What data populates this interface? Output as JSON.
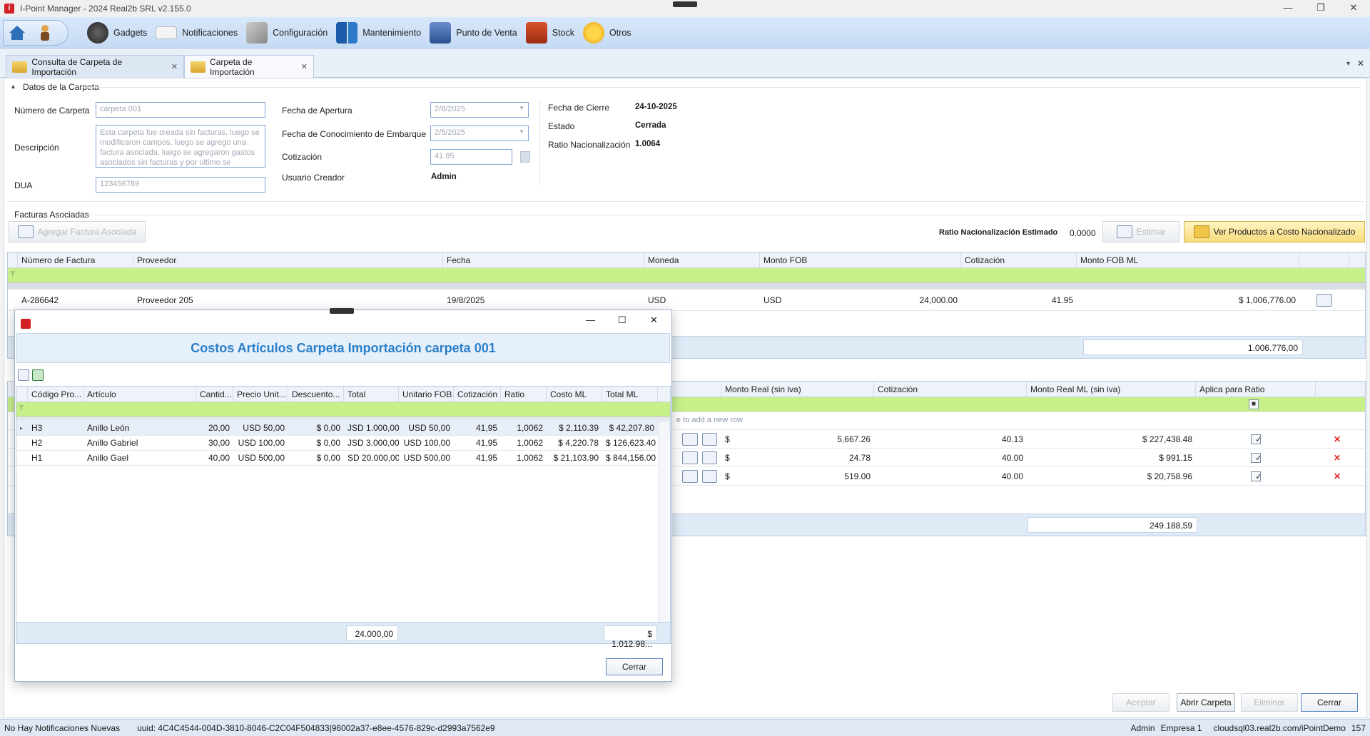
{
  "window": {
    "title": "I-Point Manager - 2024 Real2b SRL v2.155.0",
    "minimize": "—",
    "maximize": "❐",
    "close": "✕"
  },
  "menu": {
    "items": [
      "Gadgets",
      "Notificaciones",
      "Configuración",
      "Mantenimiento",
      "Punto de Venta",
      "Stock",
      "Otros"
    ]
  },
  "tabs": [
    {
      "label": "Consulta de Carpeta de Importación",
      "close": "✕"
    },
    {
      "label": "Carpeta de Importación",
      "close": "✕"
    }
  ],
  "tabstrip_icons": {
    "dropdown": "▼",
    "close": "✕"
  },
  "datos": {
    "section": "Datos de la Carpeta",
    "numero_label": "Número de Carpeta",
    "numero_value": "carpeta 001",
    "descripcion_label": "Descripción",
    "descripcion_value": "Esta carpeta fue creada sin facturas, luego se modificaron campos, luego se agrego una factura asociada, luego se agregaron gastos asociados sin facturas y por ultimo se",
    "dua_label": "DUA",
    "dua_value": "123456789",
    "apertura_label": "Fecha de Apertura",
    "apertura_value": "2/8/2025",
    "embarque_label": "Fecha de Conocimiento de Embarque",
    "embarque_value": "2/5/2025",
    "cotizacion_label": "Cotización",
    "cotizacion_value": "41.95",
    "usuario_label": "Usuario Creador",
    "usuario_value": "Admin",
    "cierre_label": "Fecha de Cierre",
    "cierre_value": "24-10-2025",
    "estado_label": "Estado",
    "estado_value": "Cerrada",
    "ratio_label": "Ratio Nacionalización",
    "ratio_value": "1.0064"
  },
  "facturas": {
    "section": "Facturas Asociadas",
    "agregar": "Agregar Factura Asociada",
    "ratio_est_label": "Ratio Nacionalización Estimado",
    "ratio_est_value": "0.0000",
    "estimar": "Estimar",
    "ver_productos": "Ver Productos a Costo Nacionalizado",
    "headers": [
      "Número de Factura",
      "Proveedor",
      "Fecha",
      "Moneda",
      "Monto FOB",
      "Cotización",
      "Monto FOB ML"
    ],
    "rows": [
      [
        "A-286642",
        "Proveedor 205",
        "19/8/2025",
        "USD",
        "USD",
        "24,000.00",
        "41.95",
        "$ 1,006,776.00"
      ]
    ],
    "total": "1.006.776,00"
  },
  "gastos": {
    "headers": [
      "Monto Real (sin iva)",
      "Cotización",
      "Monto Real ML (sin iva)",
      "Aplica para Ratio"
    ],
    "new_row": "e to add a new row",
    "rows": [
      [
        "$",
        "5,667.26",
        "40.13",
        "$ 227,438.48"
      ],
      [
        "$",
        "24.78",
        "40.00",
        "$ 991.15"
      ],
      [
        "$",
        "519.00",
        "40.00",
        "$ 20,758.96"
      ]
    ],
    "total": "249.188,59"
  },
  "footer_buttons": {
    "aceptar": "Aceptar",
    "abrir": "Abrir Carpeta",
    "eliminar": "Eliminar",
    "cerrar": "Cerrar"
  },
  "dialog": {
    "title": "Costos Artículos Carpeta Importación carpeta 001",
    "headers": [
      "Código Pro...",
      "Artículo",
      "Cantid...",
      "Precio Unit...",
      "Descuento...",
      "Total",
      "Unitario FOB",
      "Cotización",
      "Ratio",
      "Costo ML",
      "Total ML"
    ],
    "rows": [
      [
        "H3",
        "Anillo León",
        "20,00",
        "USD 50,00",
        "$ 0,00",
        "JSD 1.000,00",
        "USD 50,00",
        "41,95",
        "1,0062",
        "$ 2,110.39",
        "$ 42,207.80"
      ],
      [
        "H2",
        "Anillo Gabriel",
        "30,00",
        "USD 100,00",
        "$ 0,00",
        "JSD 3.000,00",
        "USD 100,00",
        "41,95",
        "1,0062",
        "$ 4,220.78",
        "$ 126,623.40"
      ],
      [
        "H1",
        "Anillo Gael",
        "40,00",
        "USD 500,00",
        "$ 0,00",
        "SD 20.000,00",
        "USD 500,00",
        "41,95",
        "1,0062",
        "$ 21,103.90",
        "$ 844,156.00"
      ]
    ],
    "total_sum": "24.000,00",
    "totalml_sum": "$ 1.012.98...",
    "cerrar": "Cerrar"
  },
  "status": {
    "notif": "No Hay Notificaciones Nuevas",
    "uuid": "uuid: 4C4C4544-004D-3810-8046-C2C04F504833|96002a37-e8ee-4576-829c-d2993a7562e9",
    "user": "Admin",
    "empresa": "Empresa 1",
    "server": "cloudsql03.real2b.com/iPointDemo",
    "num": "157"
  },
  "colors": {
    "accent": "#2a7fc9",
    "filter_row": "#c8f08a",
    "menubar": "#d0e2f8"
  }
}
